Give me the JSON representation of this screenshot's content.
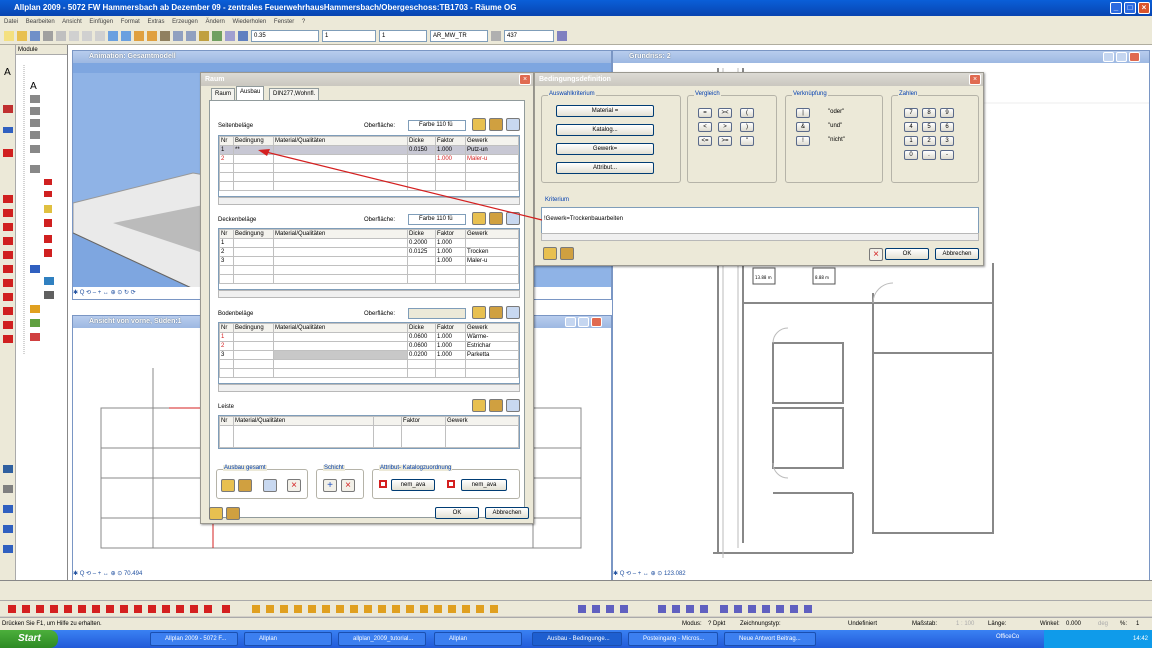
{
  "app": {
    "title": "Allplan 2009 - 5072 FW Hammersbach ab Dezember 09 - zentrales FeuerwehrhausHammersbach/Obergeschoss:TB1703 - Räume OG",
    "menu": [
      "Datei",
      "Bearbeiten",
      "Ansicht",
      "Einfügen",
      "Format",
      "Extras",
      "Erzeugen",
      "Ändern",
      "Wiederholen",
      "Fenster",
      "?"
    ]
  },
  "toolbar": {
    "pen": "0.35",
    "line": "1",
    "color": "1",
    "layer": "AR_MW_TR",
    "number": "437"
  },
  "module_panel": {
    "title": "Module"
  },
  "windows": {
    "animation": {
      "title": "Animation: Gesamtmodell"
    },
    "grundriss": {
      "title": "Grundriss: 2"
    },
    "ansicht": {
      "title": "Ansicht von vorne, Süden:1"
    },
    "scale_left": "70.494",
    "scale_right": "123.082"
  },
  "plan_labels": [
    "13.88 m",
    "8.88 m"
  ],
  "raum_dialog": {
    "title": "Raum",
    "tabs": [
      "Raum",
      "Ausbau",
      "DIN277,Wohnfl."
    ],
    "surface_label": "Oberfläche:",
    "seiten": {
      "title": "Seitenbeläge",
      "surface": "Farbe 110 fü",
      "headers": [
        "Nr",
        "Bedingung",
        "Material/Qualitäten",
        "Dicke",
        "Faktor",
        "Gewerk"
      ],
      "rows": [
        [
          "1",
          "**",
          "",
          "0.0150",
          "1.000",
          "Putz-un"
        ],
        [
          "2",
          "",
          "",
          "",
          "1.000",
          "Maler-u"
        ],
        [
          "",
          "",
          "",
          "",
          "",
          ""
        ],
        [
          "",
          "",
          "",
          "",
          "",
          ""
        ],
        [
          "",
          "",
          "",
          "",
          "",
          ""
        ]
      ]
    },
    "decken": {
      "title": "Deckenbeläge",
      "surface": "Farbe 110 fü",
      "rows": [
        [
          "1",
          "",
          "",
          "0.2000",
          "1.000",
          ""
        ],
        [
          "2",
          "",
          "",
          "0.0125",
          "1.000",
          "Trocken"
        ],
        [
          "3",
          "",
          "",
          "",
          "1.000",
          "Maler-u"
        ],
        [
          "",
          "",
          "",
          "",
          "",
          ""
        ],
        [
          "",
          "",
          "",
          "",
          "",
          ""
        ]
      ]
    },
    "boden": {
      "title": "Bodenbeläge",
      "surface": "",
      "rows": [
        [
          "1",
          "",
          "",
          "0.0600",
          "1.000",
          "Wärme-"
        ],
        [
          "2",
          "",
          "",
          "0.0600",
          "1.000",
          "Estrichar"
        ],
        [
          "3",
          "",
          "",
          "0.0200",
          "1.000",
          "Parketta"
        ],
        [
          "",
          "",
          "",
          "",
          "",
          ""
        ],
        [
          "",
          "",
          "",
          "",
          "",
          ""
        ]
      ]
    },
    "leiste": {
      "title": "Leiste",
      "headers": [
        "Nr",
        "Material/Qualitäten",
        "",
        "Faktor",
        "Gewerk"
      ]
    },
    "groups": {
      "ausbau": "Ausbau gesamt",
      "schicht": "Schicht",
      "attribut": "Attribut- Katalogzuordnung"
    },
    "nem_ava_1": "nem_ava",
    "nem_ava_2": "nem_ava",
    "ok": "OK",
    "cancel": "Abbrechen"
  },
  "bed_dialog": {
    "title": "Bedingungsdefinition",
    "auswahl": {
      "title": "Auswahlkriterium",
      "buttons": [
        "Material =",
        "Katalog...",
        "Gewerk=",
        "Attribut..."
      ]
    },
    "vergleich": {
      "title": "Vergleich",
      "buttons": [
        "=",
        "><",
        "(",
        "<",
        ">",
        ")",
        "<=",
        ">=",
        "\""
      ]
    },
    "verknuepfung": {
      "title": "Verknüpfung",
      "buttons": [
        "|",
        "&",
        "!"
      ],
      "labels": [
        "\"oder\"",
        "\"und\"",
        "\"nicht\""
      ]
    },
    "zahlen": {
      "title": "Zahlen",
      "buttons": [
        "7",
        "8",
        "9",
        "4",
        "5",
        "6",
        "1",
        "2",
        "3",
        "0",
        ".",
        "-"
      ]
    },
    "kriterium": {
      "title": "Kriterium",
      "value": "!Gewerk=Trockenbauarbeiten"
    },
    "ok": "OK",
    "cancel": "Abbrechen"
  },
  "status": {
    "hint": "Drücken Sie F1, um Hilfe zu erhalten.",
    "modus": "Modus:",
    "modus_val": "? Dpkt",
    "zeichnungstyp": "Zeichnungstyp:",
    "undefiniert": "Undefiniert",
    "massstab": "Maßstab:",
    "massstab_val": "1 : 100",
    "laenge": "Länge:",
    "winkel": "Winkel:",
    "winkel_val": "0.000",
    "deg": "deg",
    "percent": "%:",
    "percent_val": "1"
  },
  "taskbar": {
    "start": "Start",
    "tasks": [
      "Allplan 2009 - 5072 F...",
      "Allplan",
      "allplan_2009_tutorial...",
      "Allplan",
      "Ausbau - Bedingunge...",
      "Posteingang - Micros...",
      "Neue Antwort Beitrag..."
    ],
    "tray_label": "OfficeCo",
    "time": "14:42"
  },
  "colors": {
    "accent_blue": "#0a5fd8",
    "highlight_red": "#d42020",
    "model_blue": "#7ea6e0"
  }
}
